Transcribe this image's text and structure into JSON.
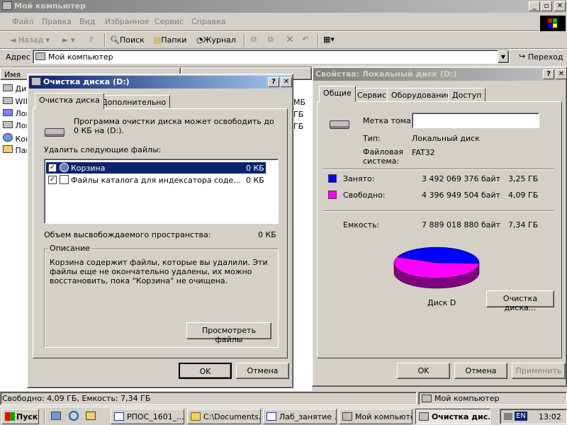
{
  "explorer": {
    "title": "Мой компьютер",
    "menu": [
      "Файл",
      "Правка",
      "Вид",
      "Избранное",
      "Сервис",
      "Справка"
    ],
    "toolbar": {
      "back": "Назад",
      "search": "Поиск",
      "folders": "Папки",
      "history": "Журнал"
    },
    "address_label": "Адрес",
    "address_value": "Мой компьютер",
    "go_label": "Переход",
    "col_name": "Имя",
    "items": [
      "Дис",
      "WIN",
      "Лок",
      "Лок",
      "Ком",
      "Пан"
    ],
    "right_frag": [
      "МБ",
      "ГБ",
      "ГБ"
    ],
    "status_left": "Свободно: 4,09 ГБ, Емкость: 7,34 ГБ",
    "status_right": "Мой компьютер"
  },
  "cleanup": {
    "title": "Очистка диска  (D:)",
    "tabs": [
      "Очистка диска",
      "Дополнительно"
    ],
    "intro": "Программа очистки диска может освободить до 0 КБ на (D:).",
    "delete_label": "Удалить следующие файлы:",
    "files": [
      {
        "name": "Корзина",
        "size": "0 КБ",
        "checked": "✓"
      },
      {
        "name": "Файлы каталога для индексатора соде...",
        "size": "0 КБ",
        "checked": "✓"
      }
    ],
    "freed_label": "Объем высвобождаемого пространства:",
    "freed_value": "0 КБ",
    "desc_title": "Описание",
    "desc_text": "Корзина содержит файлы, которые вы удалили. Эти файлы еще не окончательно удалены, их можно восстановить, пока \"Корзина\" не очищена.",
    "view_files": "Просмотреть файлы",
    "ok": "OK",
    "cancel": "Отмена"
  },
  "props": {
    "title": "Свойства: Локальный диск (D:)",
    "tabs": [
      "Общие",
      "Сервис",
      "Оборудование",
      "Доступ"
    ],
    "label_label": "Метка тома:",
    "label_value": "",
    "type_label": "Тип:",
    "type_value": "Локальный диск",
    "fs_label": "Файловая система:",
    "fs_value": "FAT32",
    "used_label": "Занято:",
    "used_bytes": "3 492 069 376 байт",
    "used_gb": "3,25 ГБ",
    "free_label": "Свободно:",
    "free_bytes": "4 396 949 504 байт",
    "free_gb": "4,09 ГБ",
    "cap_label": "Емкость:",
    "cap_bytes": "7 889 018 880 байт",
    "cap_gb": "7,34 ГБ",
    "disk_label": "Диск D",
    "cleanup_button": "Очистка диска...",
    "ok": "OK",
    "cancel": "Отмена",
    "apply": "Применить",
    "used_color": "#0000ff",
    "free_color": "#ff00ff",
    "used_fraction": 0.4427
  },
  "taskbar": {
    "start": "Пуск",
    "tasks": [
      "РПОС_1601_...",
      "C:\\Documents...",
      "Лаб_занятие ...",
      "Мой компьютер",
      "Очистка дис..."
    ],
    "lang": "EN",
    "time": "13:02"
  }
}
